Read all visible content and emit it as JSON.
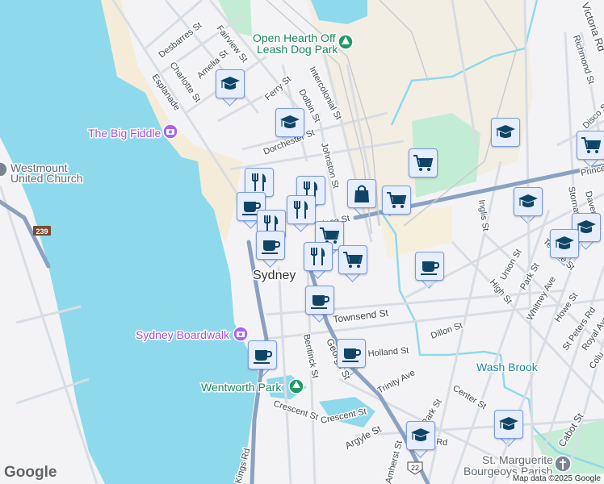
{
  "colors": {
    "water": "#8fd9ed",
    "land": "#f3f3f5",
    "park": "#f2eee3",
    "green": "#c3ecd4",
    "road": "#d8dde4",
    "major_road": "#8aa1c2",
    "marker_icon": "#0f4467",
    "poi_purple": "#a050e0",
    "poi_green": "#16845a",
    "brook": "#1c8aa0"
  },
  "places": {
    "city": "Sydney",
    "big_fiddle": "The Big Fiddle",
    "boardwalk": "Sydney Boardwalk",
    "wentworth": "Wentworth Park",
    "dog_park_line1": "Open Hearth Off",
    "dog_park_line2": "Leash Dog Park",
    "westmount_line1": "Westmount",
    "westmount_line2": "United Church",
    "wash_brook": "Wash Brook",
    "parish_line1": "St. Marguerite",
    "parish_line2": "Bourgeoys Parish"
  },
  "route_shields": {
    "r239": "239",
    "r22": "22"
  },
  "streets": [
    "Desbarres St",
    "Fairview St",
    "Amelia St",
    "Charlotte St",
    "Esplanade",
    "Ferry St",
    "Dolbin St",
    "Intercolonial St",
    "Dorchester St",
    "Johnston St",
    "Prince St",
    "Prince St",
    "Inglis St",
    "Richmond St",
    "Disco St",
    "Victoria Rd",
    "Davenport",
    "Stornaway",
    "Terrace St",
    "Townsend St",
    "Union St",
    "Park St",
    "High St",
    "Whitney Ave",
    "Howe St",
    "St Peters Rd",
    "Royal Ave",
    "Dillon St",
    "Bentinck St",
    "George St",
    "Holland St",
    "Trinity Ave",
    "Center St",
    "Crescent St",
    "Crescent St",
    "Argyle St",
    "Park St",
    "Rd",
    "Cabot St",
    "Amherst St",
    "Kings Rd",
    "Colu"
  ],
  "markers": [
    {
      "type": "school"
    },
    {
      "type": "school"
    },
    {
      "type": "restaurant"
    },
    {
      "type": "restaurant"
    },
    {
      "type": "shopping"
    },
    {
      "type": "grocery"
    },
    {
      "type": "grocery"
    },
    {
      "type": "school"
    },
    {
      "type": "grocery"
    },
    {
      "type": "school"
    },
    {
      "type": "school"
    },
    {
      "type": "school"
    },
    {
      "type": "cafe"
    },
    {
      "type": "cafe"
    },
    {
      "type": "restaurant"
    },
    {
      "type": "restaurant"
    },
    {
      "type": "cafe"
    },
    {
      "type": "grocery"
    },
    {
      "type": "restaurant"
    },
    {
      "type": "grocery"
    },
    {
      "type": "cafe"
    },
    {
      "type": "cafe"
    },
    {
      "type": "cafe"
    },
    {
      "type": "school"
    },
    {
      "type": "school"
    }
  ],
  "attribution": "Map data ©2025 Google",
  "logo": "Google"
}
